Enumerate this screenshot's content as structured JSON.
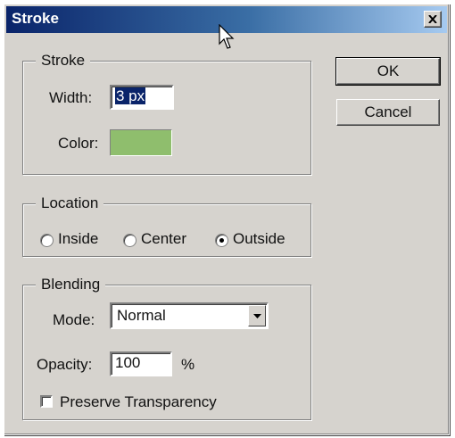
{
  "window": {
    "title": "Stroke"
  },
  "stroke": {
    "legend": "Stroke",
    "width_label": "Width:",
    "width_value": "3 px",
    "color_label": "Color:",
    "color_value": "#8fbe6d"
  },
  "location": {
    "legend": "Location",
    "options": [
      {
        "label": "Inside",
        "selected": false
      },
      {
        "label": "Center",
        "selected": false
      },
      {
        "label": "Outside",
        "selected": true
      }
    ]
  },
  "blending": {
    "legend": "Blending",
    "mode_label": "Mode:",
    "mode_value": "Normal",
    "opacity_label": "Opacity:",
    "opacity_value": "100",
    "opacity_unit": "%",
    "preserve_label": "Preserve Transparency",
    "preserve_checked": false
  },
  "buttons": {
    "ok": "OK",
    "cancel": "Cancel"
  }
}
